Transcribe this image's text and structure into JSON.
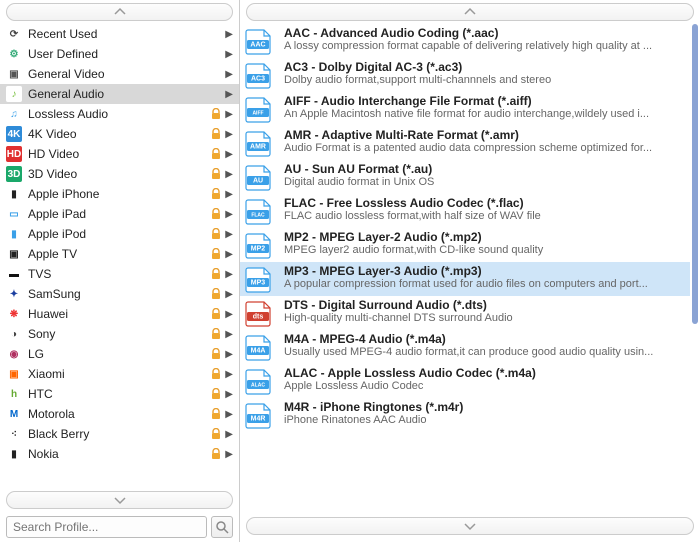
{
  "search": {
    "placeholder": "Search Profile..."
  },
  "categories": [
    {
      "label": "Recent Used",
      "icon_bg": "#fff",
      "icon_fg": "#444",
      "icon_text": "⟳",
      "locked": false,
      "selected": false
    },
    {
      "label": "User Defined",
      "icon_bg": "#fff",
      "icon_fg": "#3a7",
      "icon_text": "⚙",
      "locked": false,
      "selected": false
    },
    {
      "label": "General Video",
      "icon_bg": "#fff",
      "icon_fg": "#555",
      "icon_text": "▣",
      "locked": false,
      "selected": false
    },
    {
      "label": "General Audio",
      "icon_bg": "#fff",
      "icon_fg": "#7ac142",
      "icon_text": "♪",
      "locked": false,
      "selected": true
    },
    {
      "label": "Lossless Audio",
      "icon_bg": "#fff",
      "icon_fg": "#3aa0e8",
      "icon_text": "♫",
      "locked": true,
      "selected": false
    },
    {
      "label": "4K Video",
      "icon_bg": "#2e8bd8",
      "icon_fg": "#fff",
      "icon_text": "4K",
      "locked": true,
      "selected": false
    },
    {
      "label": "HD Video",
      "icon_bg": "#e03030",
      "icon_fg": "#fff",
      "icon_text": "HD",
      "locked": true,
      "selected": false
    },
    {
      "label": "3D Video",
      "icon_bg": "#1aa86a",
      "icon_fg": "#fff",
      "icon_text": "3D",
      "locked": true,
      "selected": false
    },
    {
      "label": "Apple iPhone",
      "icon_bg": "#fff",
      "icon_fg": "#222",
      "icon_text": "▮",
      "locked": true,
      "selected": false
    },
    {
      "label": "Apple iPad",
      "icon_bg": "#fff",
      "icon_fg": "#3aa0e8",
      "icon_text": "▭",
      "locked": true,
      "selected": false
    },
    {
      "label": "Apple iPod",
      "icon_bg": "#fff",
      "icon_fg": "#3aa0e8",
      "icon_text": "▮",
      "locked": true,
      "selected": false
    },
    {
      "label": "Apple TV",
      "icon_bg": "#fff",
      "icon_fg": "#222",
      "icon_text": "▣",
      "locked": true,
      "selected": false
    },
    {
      "label": "TVS",
      "icon_bg": "#fff",
      "icon_fg": "#111",
      "icon_text": "▬",
      "locked": true,
      "selected": false
    },
    {
      "label": "SamSung",
      "icon_bg": "#fff",
      "icon_fg": "#1b3fa0",
      "icon_text": "✦",
      "locked": true,
      "selected": false
    },
    {
      "label": "Huawei",
      "icon_bg": "#fff",
      "icon_fg": "#e33",
      "icon_text": "❋",
      "locked": true,
      "selected": false
    },
    {
      "label": "Sony",
      "icon_bg": "#fff",
      "icon_fg": "#444",
      "icon_text": "◑",
      "locked": true,
      "selected": false
    },
    {
      "label": "LG",
      "icon_bg": "#fff",
      "icon_fg": "#b03060",
      "icon_text": "◉",
      "locked": true,
      "selected": false
    },
    {
      "label": "Xiaomi",
      "icon_bg": "#fff",
      "icon_fg": "#f60",
      "icon_text": "▣",
      "locked": true,
      "selected": false
    },
    {
      "label": "HTC",
      "icon_bg": "#fff",
      "icon_fg": "#6a3",
      "icon_text": "h",
      "locked": true,
      "selected": false
    },
    {
      "label": "Motorola",
      "icon_bg": "#fff",
      "icon_fg": "#06c",
      "icon_text": "M",
      "locked": true,
      "selected": false
    },
    {
      "label": "Black Berry",
      "icon_bg": "#fff",
      "icon_fg": "#222",
      "icon_text": "⁖",
      "locked": true,
      "selected": false
    },
    {
      "label": "Nokia",
      "icon_bg": "#fff",
      "icon_fg": "#222",
      "icon_text": "▮",
      "locked": true,
      "selected": false
    }
  ],
  "formats": [
    {
      "code": "AAC",
      "color": "#3aa0e8",
      "title": "AAC - Advanced Audio Coding (*.aac)",
      "desc": "A lossy compression format capable of delivering relatively high quality at ...",
      "selected": false
    },
    {
      "code": "AC3",
      "color": "#3aa0e8",
      "title": "AC3 - Dolby Digital AC-3 (*.ac3)",
      "desc": "Dolby audio format,support multi-channnels and stereo",
      "selected": false
    },
    {
      "code": "AIFF",
      "color": "#3aa0e8",
      "title": "AIFF - Audio Interchange File Format (*.aiff)",
      "desc": "An Apple Macintosh native file format for audio interchange,wildely used i...",
      "selected": false
    },
    {
      "code": "AMR",
      "color": "#3aa0e8",
      "title": "AMR - Adaptive Multi-Rate Format (*.amr)",
      "desc": "Audio Format is a patented audio data compression scheme optimized for...",
      "selected": false
    },
    {
      "code": "AU",
      "color": "#3aa0e8",
      "title": "AU - Sun AU Format (*.au)",
      "desc": "Digital audio format in Unix OS",
      "selected": false
    },
    {
      "code": "FLAC",
      "color": "#3aa0e8",
      "title": "FLAC - Free Lossless Audio Codec (*.flac)",
      "desc": "FLAC audio lossless format,with half size of WAV file",
      "selected": false
    },
    {
      "code": "MP2",
      "color": "#3aa0e8",
      "title": "MP2 - MPEG Layer-2 Audio (*.mp2)",
      "desc": "MPEG layer2 audio format,with CD-like sound quality",
      "selected": false
    },
    {
      "code": "MP3",
      "color": "#3aa0e8",
      "title": "MP3 - MPEG Layer-3 Audio (*.mp3)",
      "desc": "A popular compression format used for audio files on computers and port...",
      "selected": true
    },
    {
      "code": "dts",
      "color": "#d04030",
      "title": "DTS - Digital Surround Audio (*.dts)",
      "desc": "High-quality multi-channel DTS surround Audio",
      "selected": false
    },
    {
      "code": "M4A",
      "color": "#3aa0e8",
      "title": "M4A - MPEG-4 Audio (*.m4a)",
      "desc": "Usually used MPEG-4 audio format,it can produce good audio quality usin...",
      "selected": false
    },
    {
      "code": "ALAC",
      "color": "#3aa0e8",
      "title": "ALAC - Apple Lossless Audio Codec (*.m4a)",
      "desc": "Apple Lossless Audio Codec",
      "selected": false
    },
    {
      "code": "M4R",
      "color": "#3aa0e8",
      "title": "M4R - iPhone Ringtones (*.m4r)",
      "desc": "iPhone Rinatones AAC Audio",
      "selected": false
    }
  ]
}
